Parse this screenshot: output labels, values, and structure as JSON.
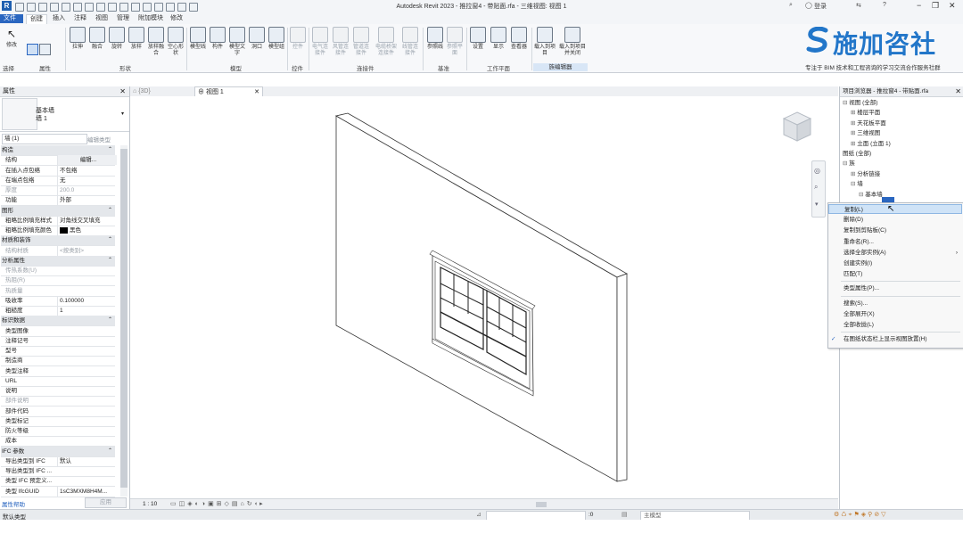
{
  "window": {
    "title": "Autodesk Revit 2023 - 推拉窗4 - 带贴面.rfa - 三维视图: 视图 1",
    "app_logo": "R",
    "user": "登录",
    "help": "?"
  },
  "tabs": [
    "文件",
    "创建",
    "插入",
    "注释",
    "视图",
    "管理",
    "附加模块",
    "修改"
  ],
  "ribbon": {
    "tools": [
      {
        "label": "修改",
        "icon": "select-cursor-icon"
      },
      {
        "label": "拉伸",
        "icon": "extrusion-icon"
      },
      {
        "label": "融合",
        "icon": "blend-icon"
      },
      {
        "label": "旋转",
        "icon": "revolve-icon"
      },
      {
        "label": "放样",
        "icon": "sweep-icon"
      },
      {
        "label": "放样融合",
        "icon": "swept-blend-icon"
      },
      {
        "label": "空心形状",
        "icon": "void-form-icon"
      },
      {
        "label": "模型线",
        "icon": "model-line-icon"
      },
      {
        "label": "构件",
        "icon": "component-icon"
      },
      {
        "label": "模型文字",
        "icon": "model-text-icon"
      },
      {
        "label": "洞口",
        "icon": "opening-icon"
      },
      {
        "label": "模型组",
        "icon": "model-group-icon"
      },
      {
        "label": "控件",
        "icon": "control-icon"
      },
      {
        "label": "电气连接件",
        "icon": "electrical-connector-icon"
      },
      {
        "label": "风管连接件",
        "icon": "duct-connector-icon"
      },
      {
        "label": "管道连接件",
        "icon": "pipe-connector-icon"
      },
      {
        "label": "电缆桥架连接件",
        "icon": "cable-tray-connector-icon"
      },
      {
        "label": "线管连接件",
        "icon": "conduit-connector-icon"
      },
      {
        "label": "参照线",
        "icon": "reference-line-icon"
      },
      {
        "label": "参照平面",
        "icon": "reference-plane-icon"
      },
      {
        "label": "设置",
        "icon": "set-workplane-icon"
      },
      {
        "label": "显示",
        "icon": "show-workplane-icon"
      },
      {
        "label": "查看器",
        "icon": "viewer-icon"
      },
      {
        "label": "载入到项目",
        "icon": "load-into-project-icon"
      },
      {
        "label": "载入到项目并关闭",
        "icon": "load-and-close-icon"
      }
    ],
    "panels": [
      "选择",
      "属性",
      "形状",
      "模型",
      "控件",
      "连接件",
      "基准",
      "工作平面",
      "族编辑器"
    ]
  },
  "brand": {
    "name": "施加咨社",
    "slogan": "专注于 BIM 技术和工程咨询的学习交流合作服务社群"
  },
  "properties": {
    "title": "属性",
    "type_name": "基本墙",
    "type_sub": "墙 1",
    "instance_selector": "墙 (1)",
    "edit_type": "编辑类型",
    "rows": [
      {
        "k": "构造",
        "v": "",
        "grp": true
      },
      {
        "k": "结构",
        "v": "编辑...",
        "grp": false
      },
      {
        "k": "在插入点包络",
        "v": "不包络",
        "grp": false
      },
      {
        "k": "在端点包络",
        "v": "无",
        "grp": false
      },
      {
        "k": "厚度",
        "v": "200.0",
        "grp": false,
        "dim": true
      },
      {
        "k": "功能",
        "v": "外部",
        "grp": false
      },
      {
        "k": "图形",
        "v": "",
        "grp": true
      },
      {
        "k": "粗略比例填充样式",
        "v": "对角线交叉填充",
        "grp": false
      },
      {
        "k": "粗略比例填充颜色",
        "v": "黑色",
        "grp": false
      },
      {
        "k": "材质和装饰",
        "v": "",
        "grp": true
      },
      {
        "k": "结构材质",
        "v": "<按类别>",
        "grp": false,
        "dim": true
      },
      {
        "k": "分析属性",
        "v": "",
        "grp": true
      },
      {
        "k": "传热系数(U)",
        "v": "",
        "grp": false,
        "dim": true
      },
      {
        "k": "热阻(R)",
        "v": "",
        "grp": false,
        "dim": true
      },
      {
        "k": "热质量",
        "v": "",
        "grp": false,
        "dim": true
      },
      {
        "k": "吸收率",
        "v": "0.100000",
        "grp": false
      },
      {
        "k": "粗糙度",
        "v": "1",
        "grp": false
      },
      {
        "k": "标识数据",
        "v": "",
        "grp": true
      },
      {
        "k": "类型图像",
        "v": "",
        "grp": false
      },
      {
        "k": "注释记号",
        "v": "",
        "grp": false
      },
      {
        "k": "型号",
        "v": "",
        "grp": false
      },
      {
        "k": "制造商",
        "v": "",
        "grp": false
      },
      {
        "k": "类型注释",
        "v": "",
        "grp": false
      },
      {
        "k": "URL",
        "v": "",
        "grp": false
      },
      {
        "k": "说明",
        "v": "",
        "grp": false
      },
      {
        "k": "部件说明",
        "v": "",
        "grp": false,
        "dim": true
      },
      {
        "k": "部件代码",
        "v": "",
        "grp": false
      },
      {
        "k": "类型标记",
        "v": "",
        "grp": false
      },
      {
        "k": "防火等级",
        "v": "",
        "grp": false
      },
      {
        "k": "成本",
        "v": "",
        "grp": false
      },
      {
        "k": "IFC 参数",
        "v": "",
        "grp": true
      },
      {
        "k": "导出类型到 IFC",
        "v": "默认",
        "grp": false
      },
      {
        "k": "导出类型到 IFC ...",
        "v": "",
        "grp": false
      },
      {
        "k": "类型 IFC 预定义...",
        "v": "",
        "grp": false
      },
      {
        "k": "类型 IfcGUID",
        "v": "1sC3MXM8H4M...",
        "grp": false
      }
    ],
    "help_link": "属性帮助",
    "apply": "应用",
    "colors": {
      "swatch": "#000000"
    }
  },
  "view_tabs": [
    {
      "label": "{3D}",
      "active": false
    },
    {
      "label": "视图 1",
      "active": true
    }
  ],
  "view_bar": {
    "scale": "1 : 10"
  },
  "browser": {
    "title": "项目浏览器 - 推拉窗4 - 带贴面.rfa",
    "items": [
      {
        "label": "视图 (全部)",
        "level": 0,
        "toggle": "⊟"
      },
      {
        "label": "楼层平面",
        "level": 1,
        "toggle": "⊞"
      },
      {
        "label": "天花板平面",
        "level": 1,
        "toggle": "⊞"
      },
      {
        "label": "三维视图",
        "level": 1,
        "toggle": "⊞"
      },
      {
        "label": "立面 (立面 1)",
        "level": 1,
        "toggle": "⊞"
      },
      {
        "label": "图纸 (全部)",
        "level": 0,
        "toggle": ""
      },
      {
        "label": "族",
        "level": 0,
        "toggle": "⊟"
      },
      {
        "label": "分析链接",
        "level": 1,
        "toggle": "⊞"
      },
      {
        "label": "墙",
        "level": 1,
        "toggle": "⊟"
      },
      {
        "label": "基本墙",
        "level": 2,
        "toggle": "⊟"
      }
    ]
  },
  "context_menu": {
    "items": [
      {
        "label": "复制(L)",
        "hl": true
      },
      {
        "label": "删除(D)"
      },
      {
        "label": "复制到剪贴板(C)"
      },
      {
        "label": "重命名(R)..."
      },
      {
        "label": "选择全部实例(A)",
        "arrow": "›"
      },
      {
        "label": "创建实例(I)"
      },
      {
        "label": "匹配(T)",
        "sep_after": true
      },
      {
        "label": "类型属性(P)...",
        "sep_after": true
      },
      {
        "label": "搜索(S)..."
      },
      {
        "label": "全部展开(X)"
      },
      {
        "label": "全部收拢(L)",
        "sep_after": true
      },
      {
        "label": "在图纸状态栏上显示视图放置(H)",
        "checked": true
      }
    ]
  },
  "status": {
    "left": "默认类型",
    "model_dropdown": "主模型",
    "count": ":0"
  }
}
